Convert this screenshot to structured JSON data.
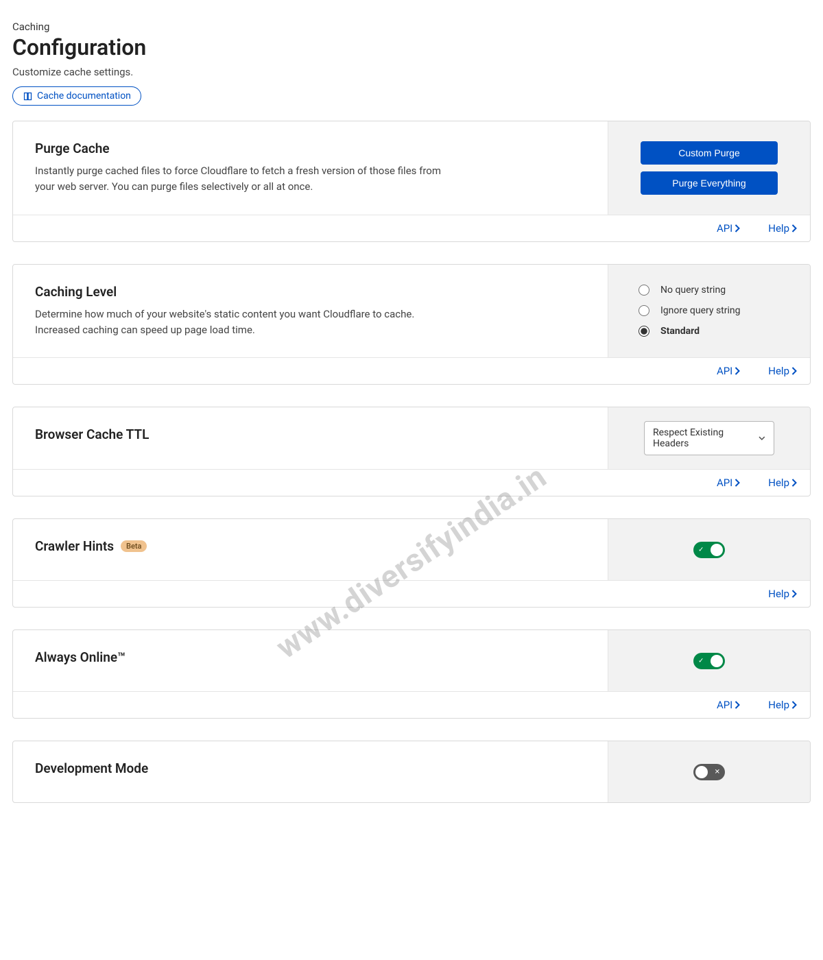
{
  "header": {
    "breadcrumb": "Caching",
    "title": "Configuration",
    "subtitle": "Customize cache settings.",
    "doc_link": "Cache documentation"
  },
  "footer_links": {
    "api": "API",
    "help": "Help"
  },
  "cards": {
    "purge": {
      "title": "Purge Cache",
      "desc": "Instantly purge cached files to force Cloudflare to fetch a fresh version of those files from your web server. You can purge files selectively or all at once.",
      "btn_custom": "Custom Purge",
      "btn_all": "Purge Everything"
    },
    "level": {
      "title": "Caching Level",
      "desc": "Determine how much of your website's static content you want Cloudflare to cache. Increased caching can speed up page load time.",
      "opt1": "No query string",
      "opt2": "Ignore query string",
      "opt3": "Standard"
    },
    "ttl": {
      "title": "Browser Cache TTL",
      "selected": "Respect Existing Headers"
    },
    "crawler": {
      "title": "Crawler Hints",
      "badge": "Beta"
    },
    "always": {
      "title": "Always Online™"
    },
    "dev": {
      "title": "Development Mode"
    }
  },
  "watermark": "www.diversifyindia.in"
}
